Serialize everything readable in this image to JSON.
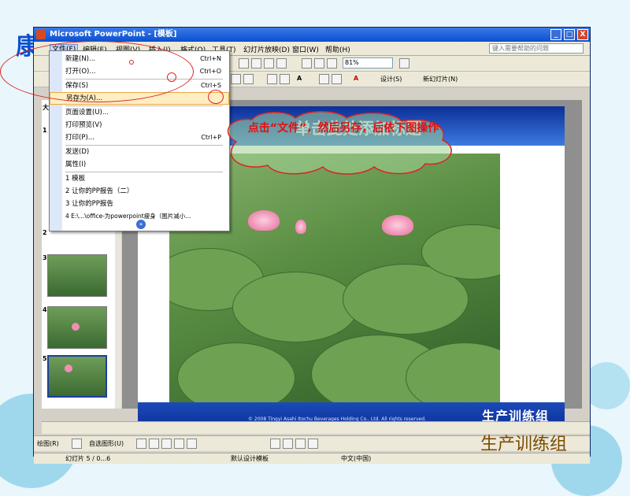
{
  "window": {
    "title": "Microsoft PowerPoint - [模板]",
    "min_btn": "_",
    "max_btn": "□",
    "close_btn": "X"
  },
  "menubar": {
    "items": [
      "文件(F)",
      "编辑(E)",
      "视图(V)",
      "插入(I)",
      "格式(O)",
      "工具(T)",
      "幻灯片放映(D)",
      "窗口(W)",
      "帮助(H)"
    ],
    "help_placeholder": "键入需要帮助的问题"
  },
  "toolbar": {
    "zoom": "81%",
    "design_label": "设计(S)",
    "new_slide_label": "新幻灯片(N)",
    "font_size_label": "A"
  },
  "file_menu": {
    "items": [
      {
        "label": "新建(N)...",
        "shortcut": "Ctrl+N"
      },
      {
        "label": "打开(O)...",
        "shortcut": "Ctrl+O"
      },
      {
        "label": "保存(S)",
        "shortcut": "Ctrl+S"
      },
      {
        "label": "另存为(A)...",
        "shortcut": ""
      },
      {
        "label": "页面设置(U)...",
        "shortcut": ""
      },
      {
        "label": "打印预览(V)",
        "shortcut": ""
      },
      {
        "label": "打印(P)...",
        "shortcut": "Ctrl+P"
      },
      {
        "label": "发送(D)",
        "shortcut": ""
      },
      {
        "label": "属性(I)",
        "shortcut": ""
      },
      {
        "label": "1 模板",
        "shortcut": ""
      },
      {
        "label": "2 让你的PP报告（二）",
        "shortcut": ""
      },
      {
        "label": "3 让你的PP报告",
        "shortcut": ""
      },
      {
        "label": "4 E:\\...\\office-为powerpoint瘦身（图片减小...",
        "shortcut": ""
      }
    ],
    "more": "»"
  },
  "slide": {
    "title_placeholder": "单击此处添加标题",
    "copyright": "© 2008 Tingyi Asahi Itochu Beverages Holding Co., Ltd. All rights reserved.",
    "team_label": "生产训练组"
  },
  "callout": {
    "text": "点击“文件”，然后另存，后依下图操作"
  },
  "thumbnails": [
    "1",
    "2",
    "3",
    "4",
    "5"
  ],
  "panel_tabs": [
    "大"
  ],
  "statusbar": {
    "slide_info": "幻灯片 5 / 0...6",
    "template": "默认设计模板",
    "language": "中文(中国)"
  },
  "drawing_toolbar": {
    "draw_label": "绘图(R)",
    "autoshape": "自选图形(U)"
  },
  "overlay_bottom": "生产训练组"
}
